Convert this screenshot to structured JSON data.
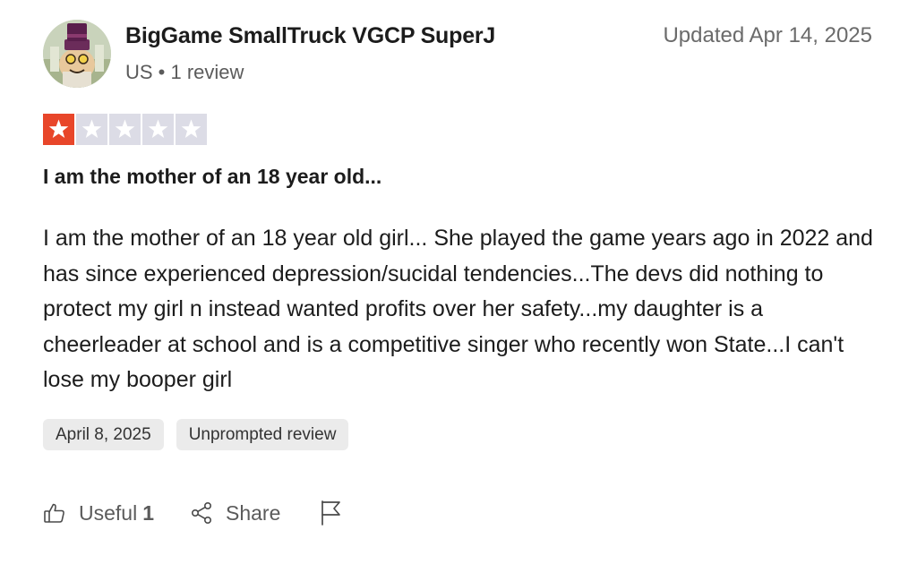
{
  "reviewer": {
    "name": "BigGame SmallTruck VGCP SuperJ",
    "country": "US",
    "separator": " • ",
    "review_count": "1 review",
    "avatar_icon": "cartoon-top-hat-character-avatar"
  },
  "review": {
    "updated": "Updated Apr 14, 2025",
    "rating": 1,
    "rating_max": 5,
    "star_filled_color": "#e8462a",
    "star_empty_color": "#dcdce6",
    "title": "I am the mother of an 18 year old...",
    "body": "I am the mother of an 18 year old girl... She played the game years ago in 2022 and has since experienced depression/sucidal tendencies...The devs did nothing to protect my girl n instead wanted profits over her safety...my daughter is a cheerleader at school and is a competitive singer who recently won State...I can't lose my booper girl",
    "tags": {
      "date": "April 8, 2025",
      "type": "Unprompted review"
    }
  },
  "actions": {
    "useful_label": "Useful",
    "useful_count": "1",
    "share_label": "Share",
    "useful_icon": "thumbs-up-icon",
    "share_icon": "share-icon",
    "flag_icon": "flag-icon"
  }
}
